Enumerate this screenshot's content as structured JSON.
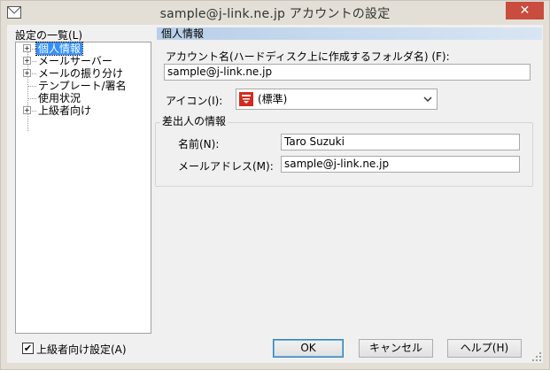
{
  "window": {
    "title": "sample@j-link.ne.jp アカウントの設定",
    "close_glyph": "✕"
  },
  "sidebar": {
    "label": "設定の一覧(L)",
    "items": [
      {
        "label": "個人情報",
        "expander": "+",
        "selected": true
      },
      {
        "label": "メールサーバー",
        "expander": "+"
      },
      {
        "label": "メールの振り分け",
        "expander": "+"
      },
      {
        "label": "テンプレート/署名"
      },
      {
        "label": "使用状況"
      },
      {
        "label": "上級者向け",
        "expander": "+"
      }
    ]
  },
  "main": {
    "section_title": "個人情報",
    "account_name_label": "アカウント名(ハードディスク上に作成するフォルダ名) (F):",
    "account_name_value": "sample@j-link.ne.jp",
    "icon_label": "アイコン(I):",
    "icon_select_value": "(標準)",
    "sender_group_title": "差出人の情報",
    "name_label": "名前(N):",
    "name_value": "Taro Suzuki",
    "email_label": "メールアドレス(M):",
    "email_value": "sample@j-link.ne.jp"
  },
  "footer": {
    "advanced_checkbox_label": "上級者向け設定(A)",
    "advanced_checkbox_checked": true,
    "check_glyph": "✔",
    "ok_label": "OK",
    "cancel_label": "キャンセル",
    "help_label": "ヘルプ(H)"
  },
  "colors": {
    "close_button": "#c94c3f",
    "selection": "#3390ff",
    "section_header": "#b8cfe9",
    "icon_red": "#d42b20"
  },
  "icons": [
    "app-icon",
    "close-icon",
    "tree-expander-icon",
    "mailbox-icon",
    "chevron-down-icon",
    "check-icon",
    "resize-grip-icon"
  ]
}
